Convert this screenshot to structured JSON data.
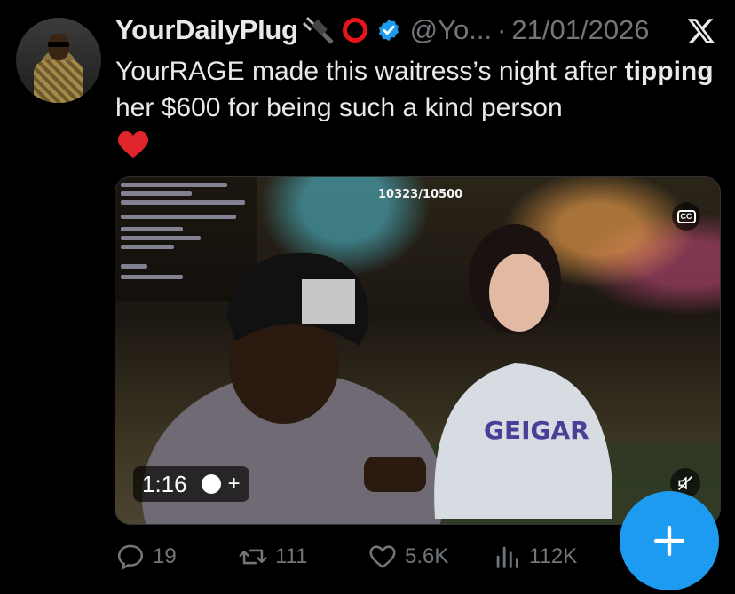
{
  "tweet": {
    "display_name": "YourDailyPlug",
    "handle": "@Yo...",
    "separator": "·",
    "date": "21/01/2026",
    "text_part1": "YourRAGE made this waitress’s night after ",
    "text_bold": "tipping",
    "text_part2": " her $600 for being such a kind person"
  },
  "media": {
    "counter_overlay": "10323/10500",
    "captions_label": "CC",
    "time": "1:16",
    "plus_label": "+",
    "colors": {
      "accent": "#1d9bf0"
    }
  },
  "actions": {
    "replies": "19",
    "reposts": "111",
    "likes": "5.6K",
    "views": "112K"
  },
  "icons": [
    "verified-badge-icon",
    "plug-emoji-icon",
    "red-circle-emoji-icon",
    "x-logo-icon",
    "heart-emoji-icon",
    "captions-icon",
    "mute-icon",
    "reply-icon",
    "repost-icon",
    "like-icon",
    "views-icon",
    "compose-plus-icon"
  ]
}
